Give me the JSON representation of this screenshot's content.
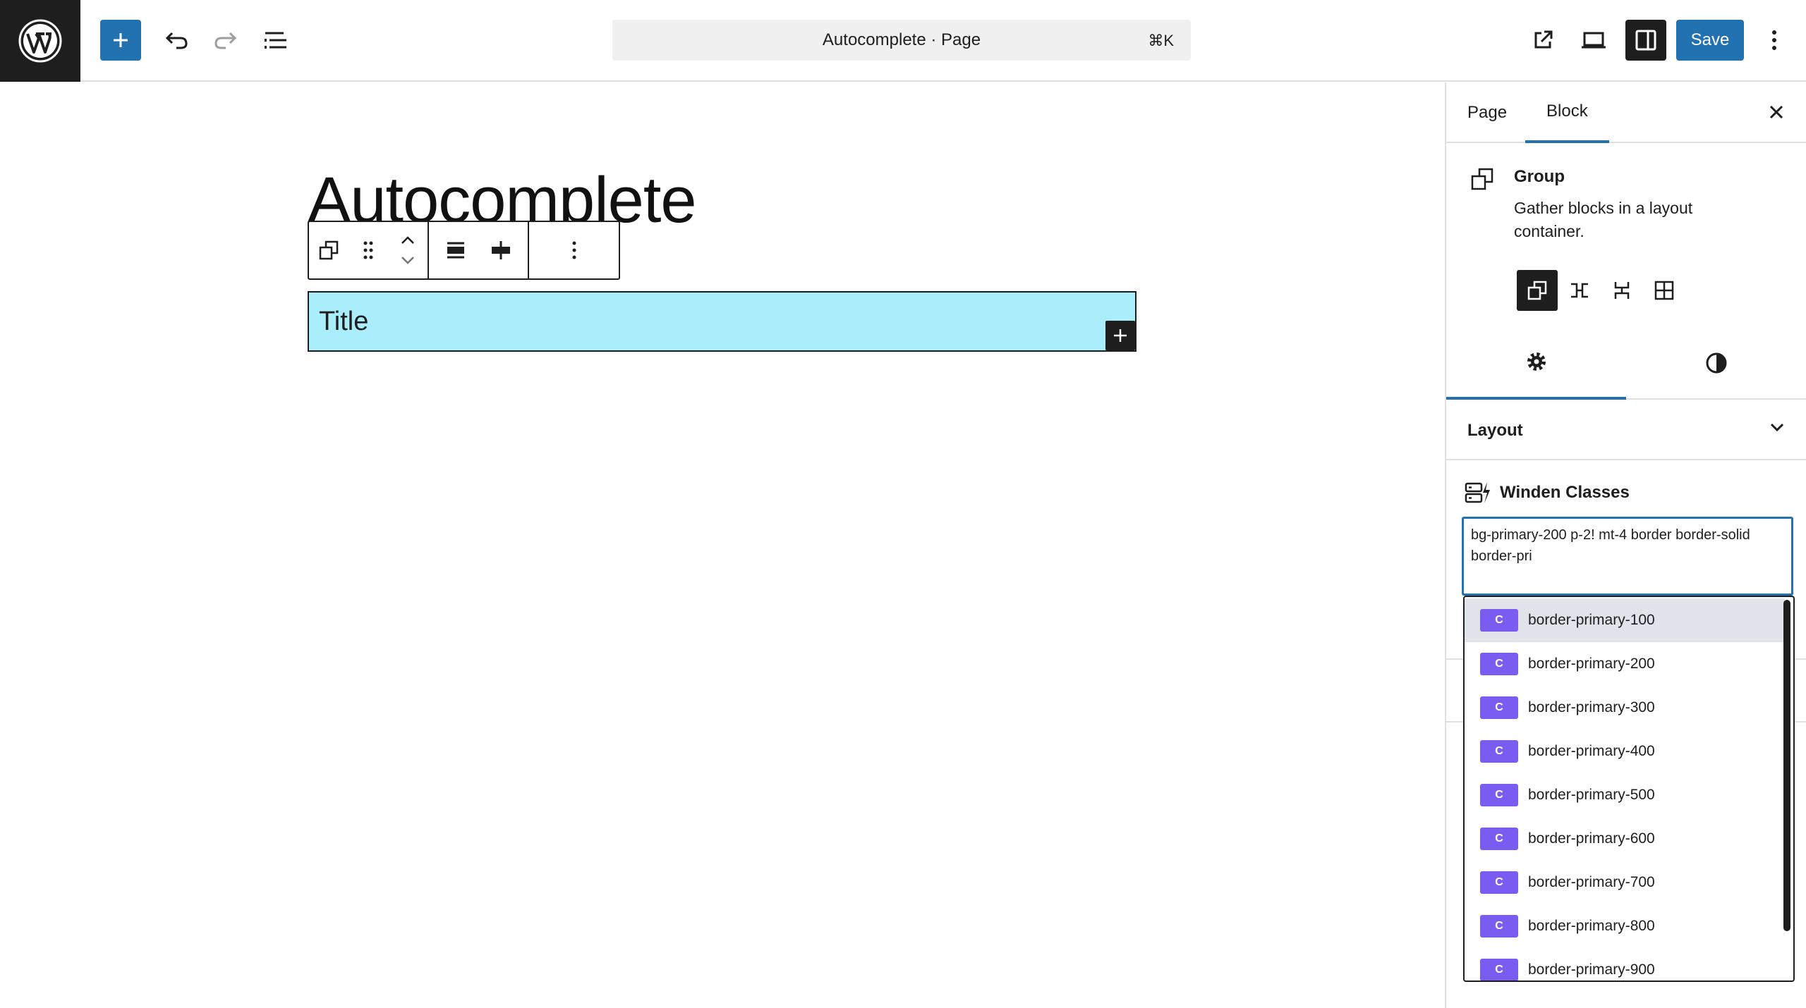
{
  "topbar": {
    "command": "Autocomplete · Page",
    "shortcut": "⌘K",
    "save_label": "Save"
  },
  "editor": {
    "page_title": "Autocomplete",
    "group_inner_text": "Title"
  },
  "sidebar": {
    "tabs": [
      {
        "label": "Page"
      },
      {
        "label": "Block"
      }
    ],
    "active_tab": "Block",
    "block": {
      "title": "Group",
      "description": "Gather blocks in a layout container."
    },
    "layout_label": "Layout",
    "winden": {
      "label": "Winden Classes",
      "value": "bg-primary-200 p-2! mt-4 border border-solid border-pri"
    }
  },
  "autocomplete": {
    "badge": "C",
    "items": [
      "border-primary-100",
      "border-primary-200",
      "border-primary-300",
      "border-primary-400",
      "border-primary-500",
      "border-primary-600",
      "border-primary-700",
      "border-primary-800",
      "border-primary-900"
    ]
  },
  "colors": {
    "accent": "#2271b1",
    "group_bg": "#aaedfb",
    "badge": "#7b5cf0"
  }
}
